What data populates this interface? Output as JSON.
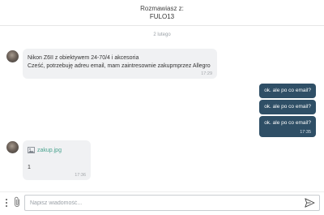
{
  "header": {
    "subtitle": "Rozmawiasz z:",
    "contact_name": "FULO13"
  },
  "thread": {
    "date_separator": "2 lutego",
    "messages": [
      {
        "direction": "incoming",
        "lines": [
          "Nikon Z6II z obiektywem 24-70/4 i akcesoria",
          "Cześć, potrzebuję adreu email, mam zaintresownie zakupmprzez Allegro"
        ],
        "time": "17:29"
      },
      {
        "direction": "outgoing",
        "text": "ok. ale po co email?"
      },
      {
        "direction": "outgoing",
        "text": "ok. ale po co email?"
      },
      {
        "direction": "outgoing",
        "text": "ok. ale po co email?",
        "time": "17:35"
      },
      {
        "direction": "incoming",
        "attachment": {
          "icon": "image-icon",
          "name": "zakup.jpg"
        },
        "text": "1",
        "time": "17:36"
      }
    ]
  },
  "composer": {
    "placeholder": "Napisz wiadomość...",
    "menu_icon": "kebab-menu-icon",
    "attach_icon": "paperclip-icon",
    "send_icon": "send-icon"
  },
  "colors": {
    "outgoing_bubble": "#2f4f66",
    "incoming_bubble": "#f0f1f3",
    "attachment_link": "#4aa38f"
  }
}
